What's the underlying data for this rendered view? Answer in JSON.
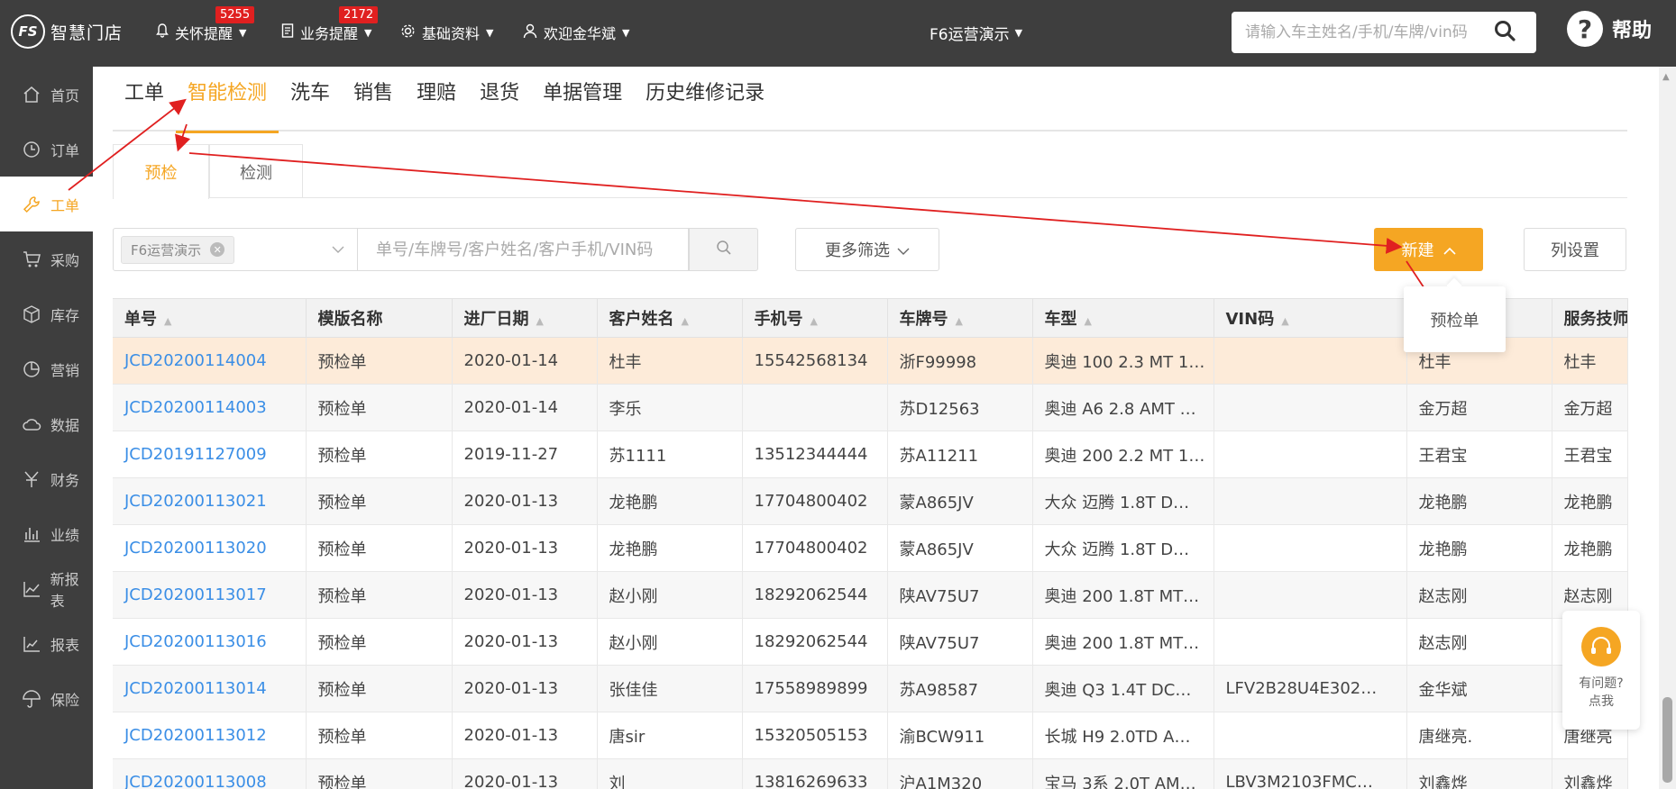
{
  "topbar": {
    "logo_text": "智慧门店",
    "logo_mark": "FS",
    "nav": [
      {
        "label": "关怀提醒",
        "badge": "5255"
      },
      {
        "label": "业务提醒",
        "badge": "2172"
      },
      {
        "label": "基础资料",
        "badge": null
      },
      {
        "label": "欢迎金华斌",
        "badge": null
      }
    ],
    "store": "F6运营演示",
    "search_placeholder": "请输入车主姓名/手机/车牌/vin码",
    "help": "帮助"
  },
  "sidebar": {
    "items": [
      {
        "label": "首页",
        "icon": "home-icon"
      },
      {
        "label": "订单",
        "icon": "clock-icon"
      },
      {
        "label": "工单",
        "icon": "wrench-icon"
      },
      {
        "label": "采购",
        "icon": "cart-icon"
      },
      {
        "label": "库存",
        "icon": "box-icon"
      },
      {
        "label": "营销",
        "icon": "pie-icon"
      },
      {
        "label": "数据",
        "icon": "cloud-icon"
      },
      {
        "label": "财务",
        "icon": "yen-icon"
      },
      {
        "label": "业绩",
        "icon": "bar-chart-icon"
      },
      {
        "label": "新报表",
        "icon": "line-chart-icon"
      },
      {
        "label": "报表",
        "icon": "report-icon"
      },
      {
        "label": "保险",
        "icon": "umbrella-icon"
      }
    ],
    "active": 2
  },
  "tabs": [
    "工单",
    "智能检测",
    "洗车",
    "销售",
    "理赔",
    "退货",
    "单据管理",
    "历史维修记录"
  ],
  "active_tab": 1,
  "subtabs": [
    "预检",
    "检测"
  ],
  "filter": {
    "store_chip": "F6运营演示",
    "query_placeholder": "单号/车牌号/客户姓名/客户手机/VIN码",
    "more": "更多筛选",
    "new": "新建",
    "columns": "列设置",
    "dropdown_item": "预检单"
  },
  "table": {
    "headers": [
      "单号",
      "模版名称",
      "进厂日期",
      "客户姓名",
      "手机号",
      "车牌号",
      "车型",
      "VIN码",
      "",
      "服务技师"
    ],
    "rows": [
      [
        "JCD20200114004",
        "预检单",
        "2020-01-14",
        "杜丰",
        "15542568134",
        "浙F99998",
        "奥迪 100 2.3 MT 1…",
        "",
        "杜丰",
        "杜丰"
      ],
      [
        "JCD20200114003",
        "预检单",
        "2020-01-14",
        "李乐",
        "",
        "苏D12563",
        "奥迪 A6 2.8 AMT …",
        "",
        "金万超",
        "金万超"
      ],
      [
        "JCD20191127009",
        "预检单",
        "2019-11-27",
        "苏1111",
        "13512344444",
        "苏A11211",
        "奥迪 200 2.2 MT 1…",
        "",
        "王君宝",
        "王君宝"
      ],
      [
        "JCD20200113021",
        "预检单",
        "2020-01-13",
        "龙艳鹏",
        "17704800402",
        "蒙A865JV",
        "大众 迈腾 1.8T D…",
        "",
        "龙艳鹏",
        "龙艳鹏"
      ],
      [
        "JCD20200113020",
        "预检单",
        "2020-01-13",
        "龙艳鹏",
        "17704800402",
        "蒙A865JV",
        "大众 迈腾 1.8T D…",
        "",
        "龙艳鹏",
        "龙艳鹏"
      ],
      [
        "JCD20200113017",
        "预检单",
        "2020-01-13",
        "赵小刚",
        "18292062544",
        "陕AV75U7",
        "奥迪 200 1.8T MT…",
        "",
        "赵志刚",
        "赵志刚"
      ],
      [
        "JCD20200113016",
        "预检单",
        "2020-01-13",
        "赵小刚",
        "18292062544",
        "陕AV75U7",
        "奥迪 200 1.8T MT…",
        "",
        "赵志刚",
        ""
      ],
      [
        "JCD20200113014",
        "预检单",
        "2020-01-13",
        "张佳佳",
        "17558989899",
        "苏A98587",
        "奥迪 Q3 1.4T DC…",
        "LFV2B28U4E302…",
        "金华斌",
        ""
      ],
      [
        "JCD20200113012",
        "预检单",
        "2020-01-13",
        "唐sir",
        "15320505153",
        "渝BCW911",
        "长城 H9 2.0TD A…",
        "",
        "唐继亮.",
        "唐继亮"
      ],
      [
        "JCD20200113008",
        "预检单",
        "2020-01-13",
        "刘",
        "13816269633",
        "沪A1M320",
        "宝马 3系 2.0T AM…",
        "LBV3M2103FMC…",
        "刘鑫烨",
        "刘鑫烨"
      ]
    ]
  },
  "chat": {
    "line1": "有问题?",
    "line2": "点我"
  },
  "colors": {
    "accent": "#f5a623",
    "link": "#3a8ee6",
    "bar": "#3e3e3e",
    "annotation": "#e02020"
  }
}
